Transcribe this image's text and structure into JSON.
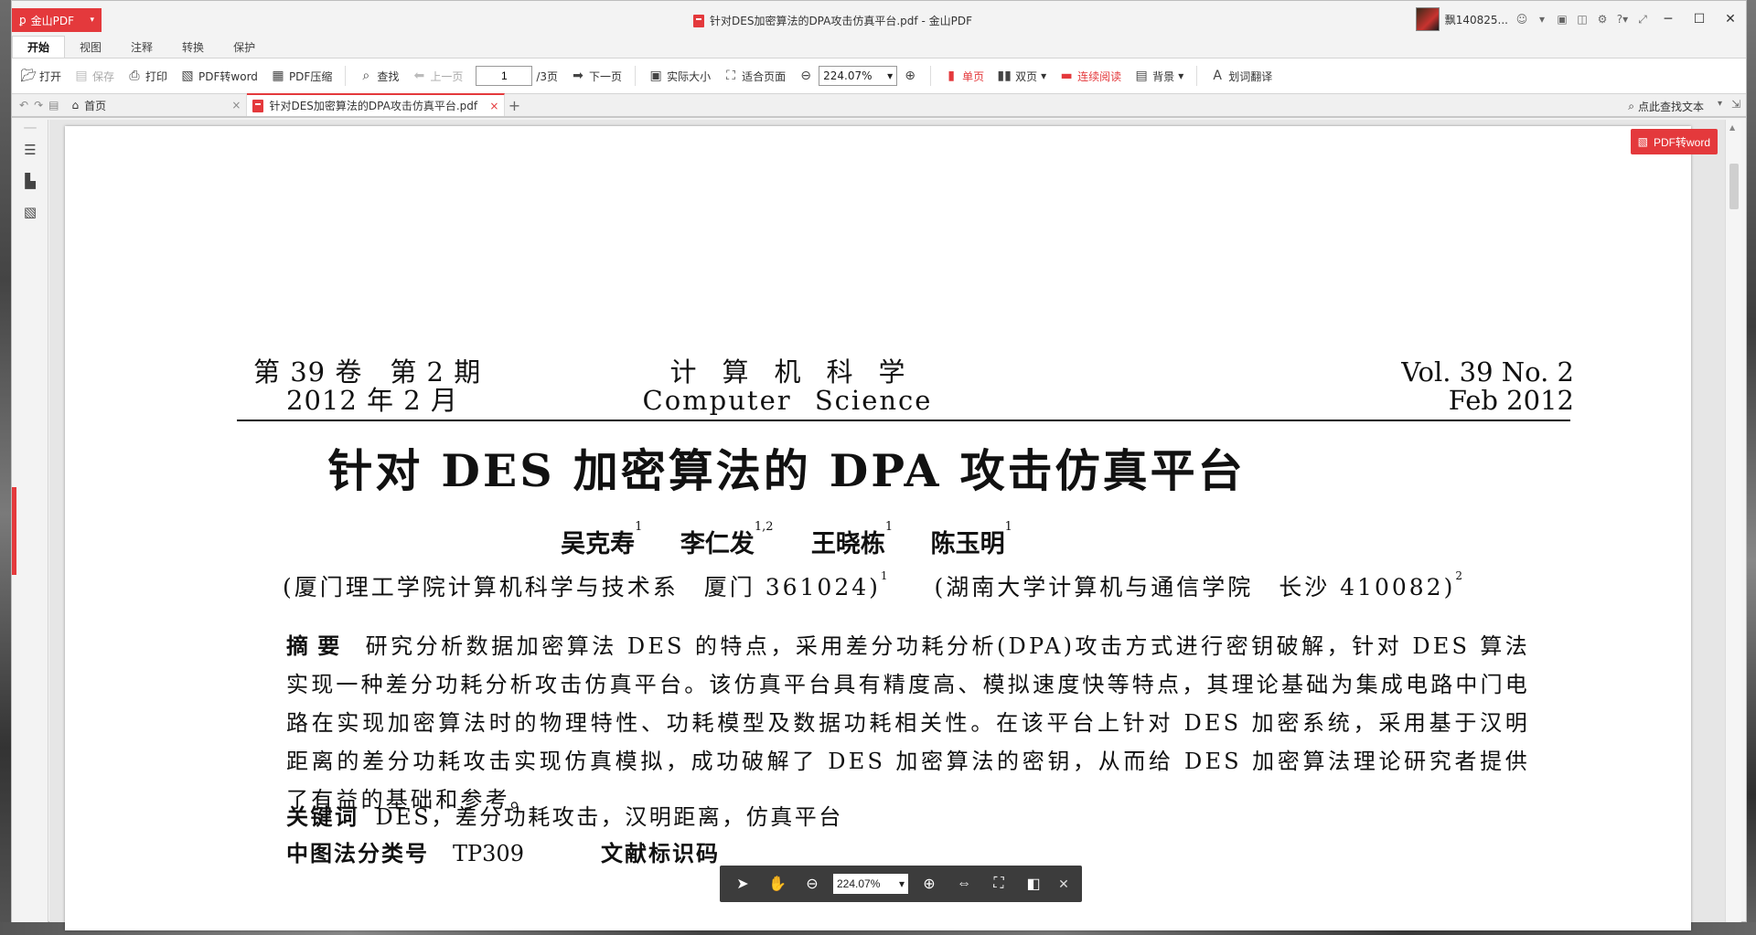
{
  "app": {
    "logo_label": "金山PDF",
    "window_title": "针对DES加密算法的DPA攻击仿真平台.pdf - 金山PDF",
    "user_name": "飘140825...",
    "colors": {
      "accent": "#e4393c",
      "toolbar_bg": "#ffffff",
      "float_bar_bg": "#3c3c3c"
    }
  },
  "ribbon": {
    "tabs": [
      {
        "label": "开始",
        "active": true
      },
      {
        "label": "视图"
      },
      {
        "label": "注释"
      },
      {
        "label": "转换"
      },
      {
        "label": "保护"
      }
    ]
  },
  "toolbar": {
    "open": "打开",
    "save": "保存",
    "print": "打印",
    "pdf_to_word": "PDF转word",
    "pdf_compress": "PDF压缩",
    "find": "查找",
    "prev_page": "上一页",
    "page_current": "1",
    "page_total": "/3页",
    "next_page": "下一页",
    "actual_size": "实际大小",
    "fit_page": "适合页面",
    "zoom_value": "224.07%",
    "single_page": "单页",
    "double_page": "双页",
    "continuous": "连续阅读",
    "background": "背景",
    "translate": "划词翻译"
  },
  "tabs": {
    "home": "首页",
    "document": "针对DES加密算法的DPA攻击仿真平台.pdf",
    "find_text": "点此查找文本"
  },
  "float_button": {
    "label": "PDF转word"
  },
  "document": {
    "header_left_1": "第 39 卷　第 2 期",
    "header_left_2": "2012 年 2 月",
    "header_center_cn": "计算机科学",
    "header_center_en": "Computer Science",
    "header_right_1": "Vol. 39 No. 2",
    "header_right_2": "Feb 2012",
    "title": "针对 DES 加密算法的 DPA 攻击仿真平台",
    "authors": [
      {
        "name": "吴克寿",
        "sup": "1"
      },
      {
        "name": "李仁发",
        "sup": "1,2"
      },
      {
        "name": "王晓栋",
        "sup": "1"
      },
      {
        "name": "陈玉明",
        "sup": "1"
      }
    ],
    "affil_1": "(厦门理工学院计算机科学与技术系　厦门 361024)",
    "affil_1_sup": "1",
    "affil_2": "(湖南大学计算机与通信学院　长沙 410082)",
    "affil_2_sup": "2",
    "abstract_label": "摘要",
    "abstract_text": "研究分析数据加密算法 DES 的特点，采用差分功耗分析(DPA)攻击方式进行密钥破解，针对 DES 算法实现一种差分功耗分析攻击仿真平台。该仿真平台具有精度高、模拟速度快等特点，其理论基础为集成电路中门电路在实现加密算法时的物理特性、功耗模型及数据功耗相关性。在该平台上针对 DES 加密系统，采用基于汉明距离的差分功耗攻击实现仿真模拟，成功破解了 DES 加密算法的密钥，从而给 DES 加密算法理论研究者提供了有益的基础和参考。",
    "keywords_label": "关键词",
    "keywords": "DES，差分功耗攻击，汉明距离，仿真平台",
    "clc_label": "中图法分类号",
    "clc_value": "TP309",
    "doc_id_label": "文献标识码"
  },
  "float_bar": {
    "zoom_value": "224.07%"
  }
}
